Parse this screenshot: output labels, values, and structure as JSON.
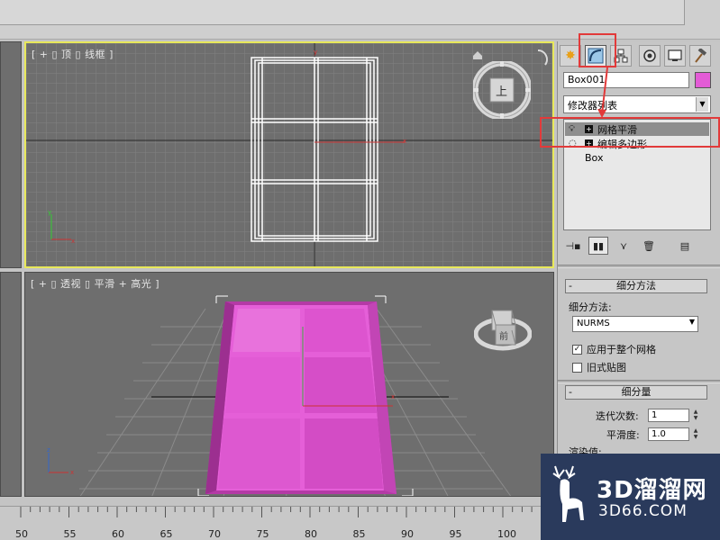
{
  "viewports": {
    "top_label": "[ + ▯ 顶 ▯ 线框 ]",
    "persp_label": "[ + ▯ 透视 ▯ 平滑 + 高光 ]",
    "viewcube_top_face": "上",
    "viewcube_persp_face": "前"
  },
  "panel": {
    "object_name": "Box001",
    "object_color": "#e35bd6",
    "modifier_list": "修改器列表",
    "stack": [
      {
        "label": "网格平滑",
        "selected": true
      },
      {
        "label": "编辑多边形",
        "selected": false
      },
      {
        "label": "Box",
        "selected": false
      }
    ],
    "rollouts": {
      "subdivision_method": {
        "title": "细分方法",
        "method_label": "细分方法:",
        "method_value": "NURMS",
        "apply_whole_mesh": "应用于整个网格",
        "apply_whole_mesh_checked": true,
        "old_style_mapping": "旧式贴图",
        "old_style_mapping_checked": false
      },
      "subdivision_amount": {
        "title": "细分量",
        "iterations_label": "迭代次数:",
        "iterations_value": "1",
        "smoothness_label": "平滑度:",
        "smoothness_value": "1.0",
        "render_values_label": "渲染值:"
      }
    }
  },
  "ruler": {
    "ticks": [
      "50",
      "55",
      "60",
      "65",
      "70",
      "75",
      "80",
      "85",
      "90",
      "95",
      "100"
    ]
  },
  "watermark": {
    "brand": "3D溜溜网",
    "url": "3D66.COM"
  },
  "colors": {
    "active_viewport_border": "#e8e85a",
    "annotation_red": "#e23a3a",
    "object_pink": "#e35bd6"
  }
}
